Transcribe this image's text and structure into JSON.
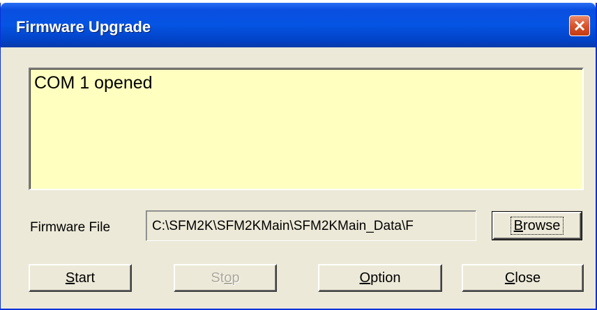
{
  "window": {
    "title": "Firmware Upgrade",
    "close_icon": "close-x-icon"
  },
  "log": {
    "text": "COM 1 opened",
    "background": "#ffffc0"
  },
  "firmware": {
    "label": "Firmware File",
    "path": "C:\\SFM2K\\SFM2KMain\\SFM2KMain_Data\\F"
  },
  "buttons": {
    "browse": {
      "mnemonic": "B",
      "rest": "rowse"
    },
    "start": {
      "mnemonic": "S",
      "rest": "tart"
    },
    "stop": {
      "lead": "St",
      "mnemonic": "o",
      "rest": "p",
      "disabled": true
    },
    "option": {
      "mnemonic": "O",
      "rest": "ption"
    },
    "close": {
      "mnemonic": "C",
      "rest": "lose"
    }
  },
  "colors": {
    "titlebar": "#0554e3",
    "dialog_bg": "#ece9d8",
    "close_button": "#d9542a"
  }
}
